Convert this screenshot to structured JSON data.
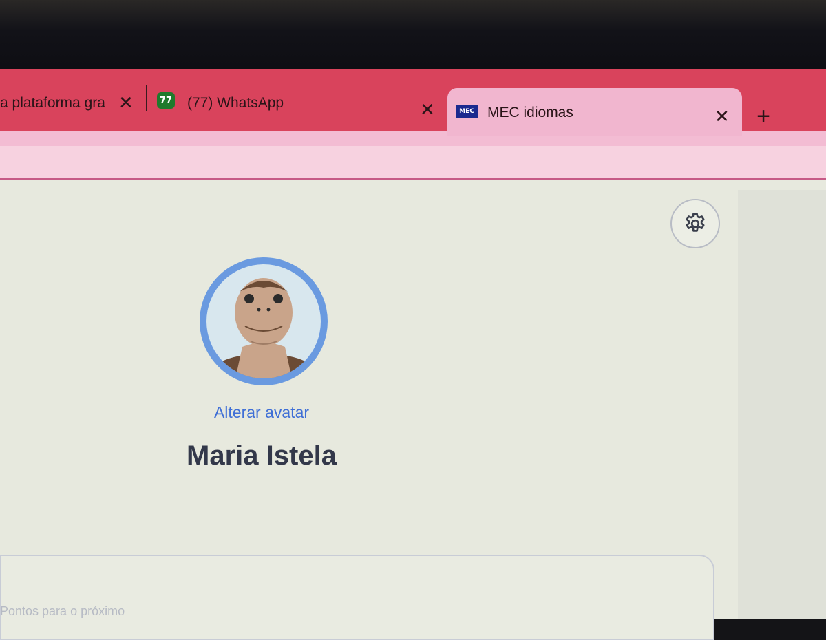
{
  "browser": {
    "tabs": [
      {
        "title": "a plataforma gra",
        "close": "✕"
      },
      {
        "favicon_text": "77",
        "title": "(77) WhatsApp",
        "close": "✕"
      },
      {
        "favicon_text": "MEC",
        "title": "MEC idiomas",
        "close": "✕",
        "active": true
      }
    ],
    "new_tab": "+"
  },
  "profile": {
    "change_avatar_label": "Alterar avatar",
    "name": "Maria Istela",
    "avatar_icon": "turtle-avatar"
  },
  "settings": {
    "icon": "gear-icon"
  },
  "card": {
    "partial_text": "Pontos para o próximo"
  },
  "colors": {
    "tab_strip": "#d9435c",
    "active_tab": "#f1b6cf",
    "link": "#3f6fd6",
    "avatar_ring": "#6a9ae0",
    "name": "#33384a"
  }
}
